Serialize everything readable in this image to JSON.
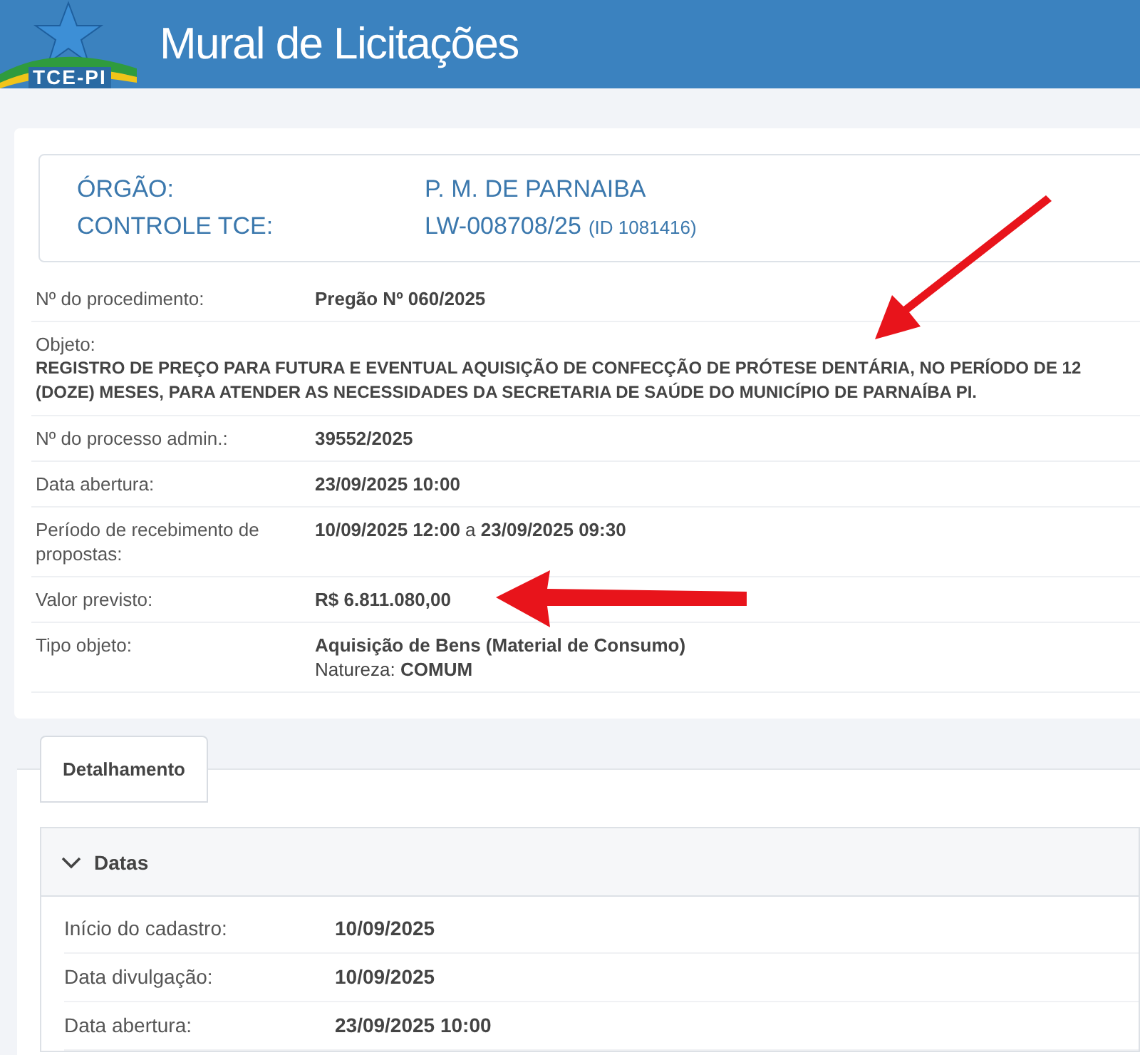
{
  "header": {
    "logo_text": "TCE-PI",
    "title": "Mural de Licitações"
  },
  "summary": [
    {
      "label": "ÓRGÃO:",
      "value": "P. M. DE PARNAIBA"
    },
    {
      "label": "CONTROLE TCE:",
      "value": "LW-008708/25",
      "id": "(ID 1081416)"
    }
  ],
  "details": [
    {
      "kind": "inline",
      "label": "Nº do procedimento:",
      "value": "Pregão Nº 060/2025",
      "bold": true
    },
    {
      "kind": "stacked",
      "label": "Objeto:",
      "value": "REGISTRO DE PREÇO PARA FUTURA E EVENTUAL AQUISIÇÃO DE CONFECÇÃO DE PRÓTESE DENTÁRIA, NO PERÍODO DE 12 (DOZE) MESES, PARA ATENDER AS NECESSIDADES DA SECRETARIA DE SAÚDE DO MUNICÍPIO DE PARNAÍBA PI.",
      "bold": true
    },
    {
      "kind": "inline",
      "label": "Nº do processo admin.:",
      "value": "39552/2025",
      "bold": true
    },
    {
      "kind": "inline",
      "label": "Data abertura:",
      "value": "23/09/2025 10:00",
      "bold": true
    },
    {
      "kind": "inline",
      "label": "Período de recebimento de propostas:",
      "value": "**10/09/2025 12:00** a **23/09/2025 09:30**",
      "bold": false
    },
    {
      "kind": "inline",
      "label": "Valor previsto:",
      "value": "R$ 6.811.080,00",
      "bold": true
    },
    {
      "kind": "inline",
      "label": "Tipo objeto:",
      "value": "Aquisição de Bens (Material de Consumo)",
      "bold": true,
      "note": "Natureza: **COMUM**"
    }
  ],
  "tabs": [
    {
      "label": "Detalhamento",
      "selected": true
    }
  ],
  "section": {
    "title": "Datas",
    "expanded": true,
    "rows": [
      {
        "label": "Início do cadastro:",
        "value": "10/09/2025"
      },
      {
        "label": "Data divulgação:",
        "value": "10/09/2025"
      },
      {
        "label": "Data abertura:",
        "value": "23/09/2025 10:00"
      }
    ]
  }
}
